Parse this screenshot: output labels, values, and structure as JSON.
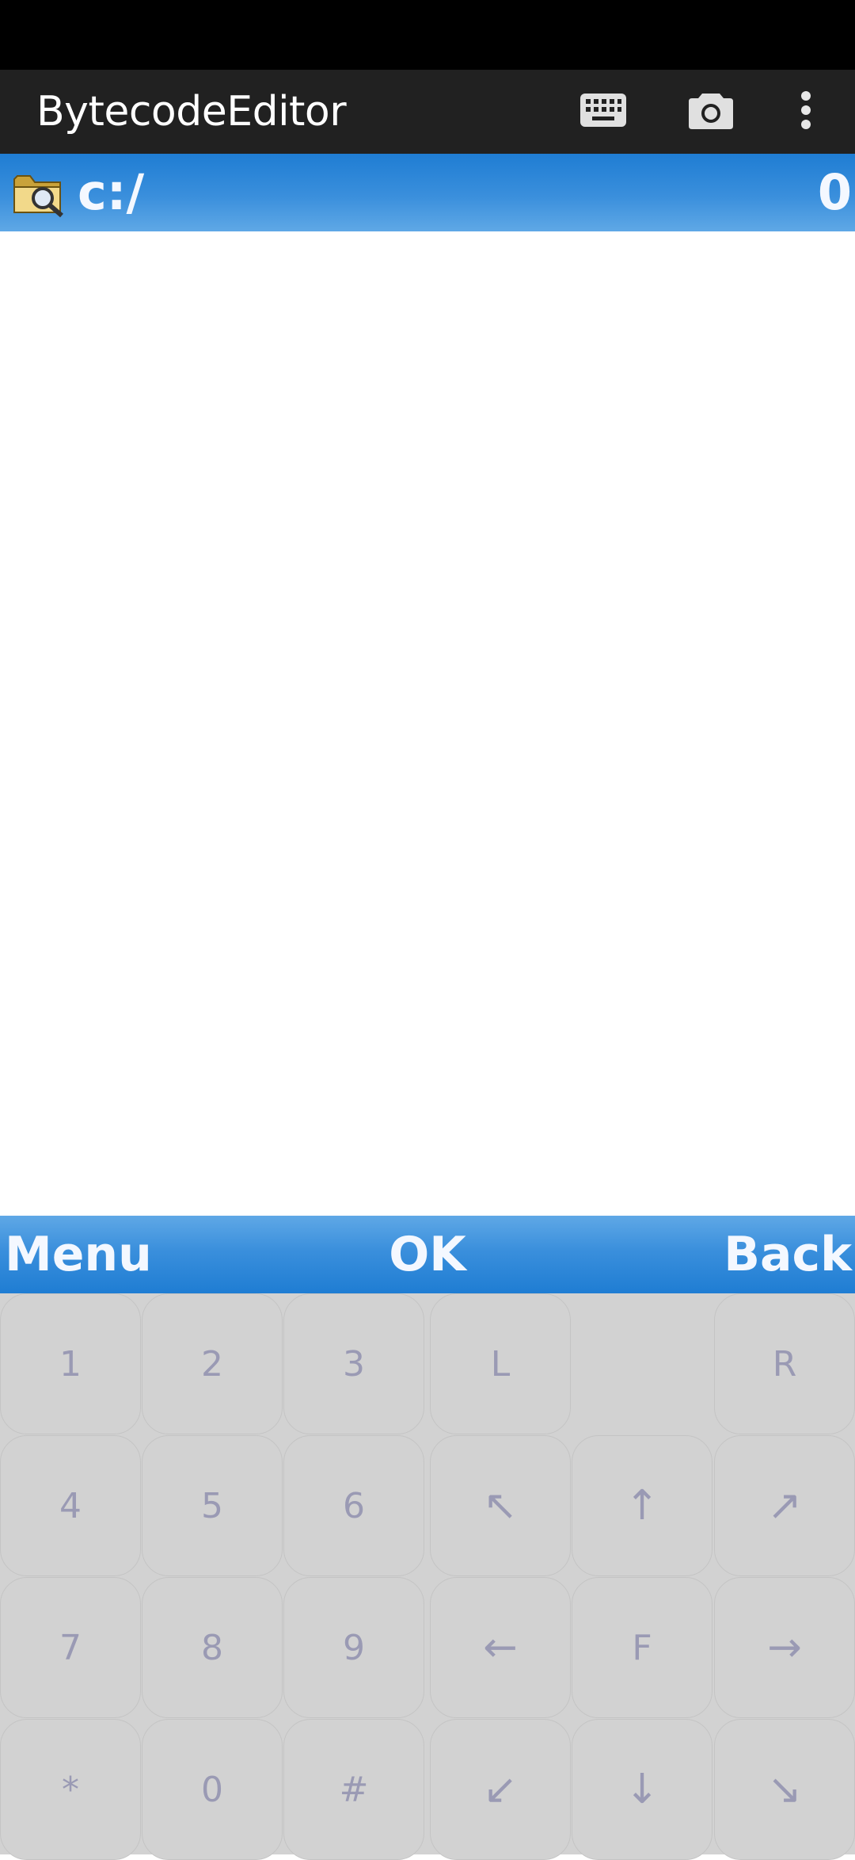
{
  "app_bar": {
    "title": "BytecodeEditor",
    "actions": [
      {
        "name": "keyboard",
        "icon": "keyboard-icon"
      },
      {
        "name": "screenshot",
        "icon": "camera-icon"
      },
      {
        "name": "overflow-menu",
        "icon": "more-vert-icon"
      }
    ]
  },
  "path_bar": {
    "icon": "folder-search-icon",
    "path": "c:/",
    "count": "0"
  },
  "softkeys": {
    "left": "Menu",
    "center": "OK",
    "right": "Back"
  },
  "keypad": {
    "rows": [
      [
        "1",
        "2",
        "3",
        "L",
        "",
        "R"
      ],
      [
        "4",
        "5",
        "6",
        "↖",
        "↑",
        "↗"
      ],
      [
        "7",
        "8",
        "9",
        "←",
        "F",
        "→"
      ],
      [
        "*",
        "0",
        "#",
        "↙",
        "↓",
        "↘"
      ]
    ]
  },
  "colors": {
    "app_bar": "#212121",
    "status_bar": "#000000",
    "bar_blue": "#3a8fdc",
    "keypad_bg": "#d2d2d2",
    "key_text": "#9a9ab4"
  }
}
